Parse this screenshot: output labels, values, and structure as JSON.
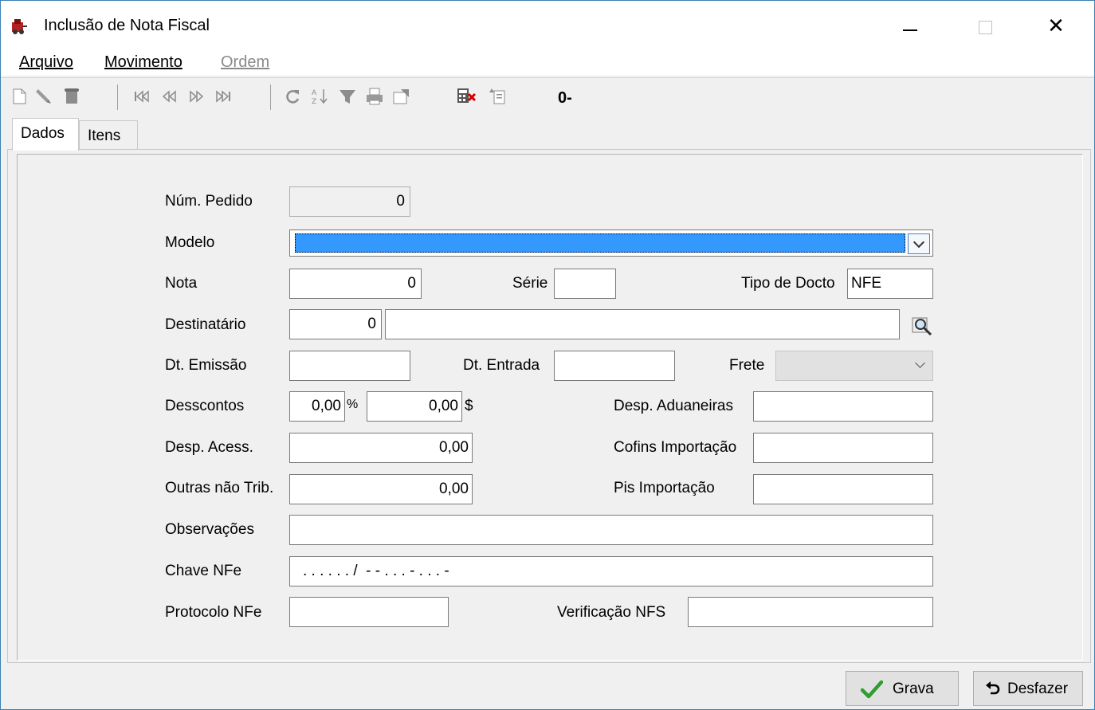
{
  "window": {
    "title": "Inclusão de Nota Fiscal",
    "close_glyph": "✕"
  },
  "menu": {
    "arquivo": "Arquivo",
    "movimento": "Movimento",
    "ordem": "Ordem"
  },
  "toolbar": {
    "record_label": "0-"
  },
  "tabs": {
    "dados": "Dados",
    "itens": "Itens"
  },
  "form": {
    "num_pedido": {
      "label": "Núm. Pedido",
      "value": "0"
    },
    "modelo": {
      "label": "Modelo",
      "value": ""
    },
    "nota": {
      "label": "Nota",
      "value": "0"
    },
    "serie": {
      "label": "Série",
      "value": ""
    },
    "tipo_docto": {
      "label": "Tipo de Docto",
      "value": "NFE"
    },
    "destinatario": {
      "label": "Destinatário",
      "code": "0",
      "name": ""
    },
    "dt_emissao": {
      "label": "Dt. Emissão",
      "value": ""
    },
    "dt_entrada": {
      "label": "Dt. Entrada",
      "value": ""
    },
    "frete": {
      "label": "Frete",
      "value": ""
    },
    "descontos": {
      "label": "Desscontos",
      "percent": "0,00",
      "percent_unit": "%",
      "amount": "0,00",
      "amount_unit": "$"
    },
    "desp_aduaneiras": {
      "label": "Desp. Aduaneiras",
      "value": ""
    },
    "desp_acess": {
      "label": "Desp. Acess.",
      "value": "0,00"
    },
    "cofins_importacao": {
      "label": "Cofins Importação",
      "value": ""
    },
    "outras_nao_trib": {
      "label": "Outras não Trib.",
      "value": "0,00"
    },
    "pis_importacao": {
      "label": "Pis Importação",
      "value": ""
    },
    "observacoes": {
      "label": "Observações",
      "value": ""
    },
    "chave_nfe": {
      "label": "Chave NFe",
      "value": ". . . . . . /  - - . . . - . . . -"
    },
    "protocolo_nfe": {
      "label": "Protocolo NFe",
      "value": ""
    },
    "verificacao_nfs": {
      "label": "Verificação NFS",
      "value": ""
    }
  },
  "buttons": {
    "grava": "Grava",
    "desfazer": "Desfazer"
  },
  "colors": {
    "selection": "#3399ff",
    "accent_green": "#2e9e2e"
  }
}
